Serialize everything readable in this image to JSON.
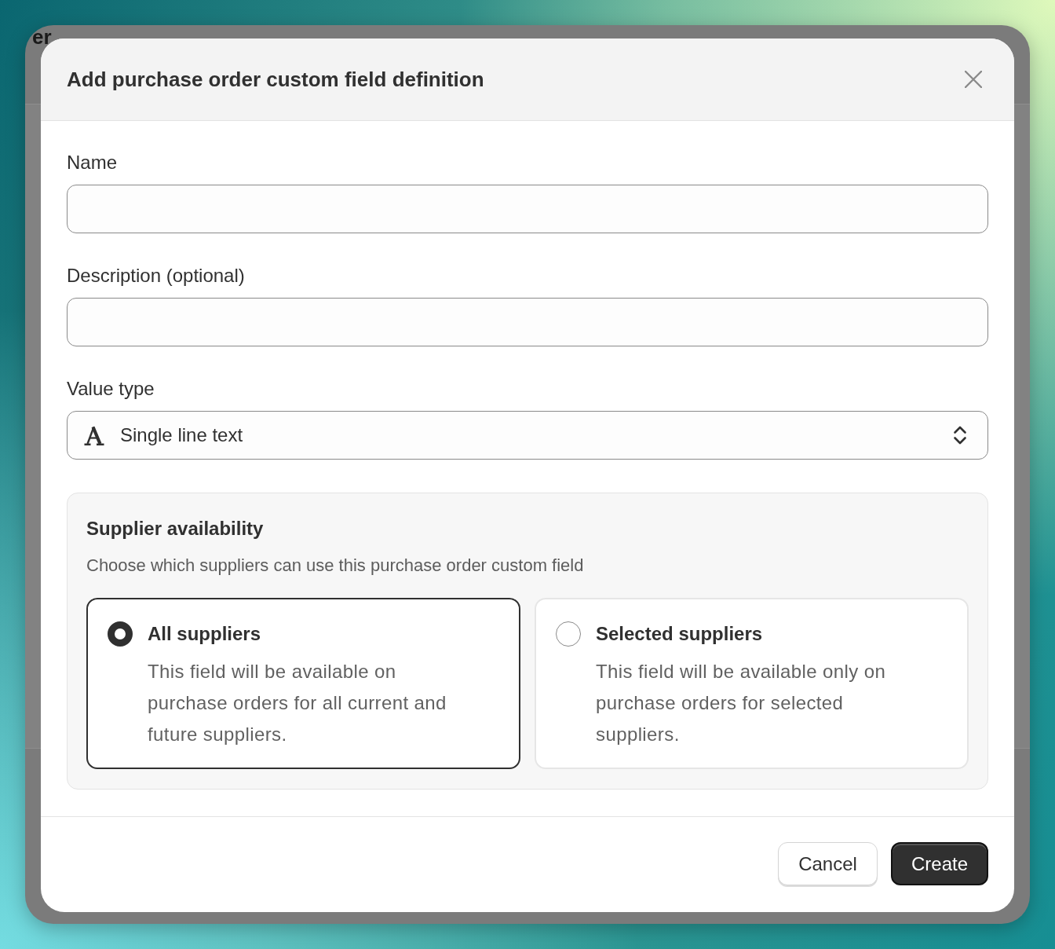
{
  "background_page": {
    "title": "er"
  },
  "dialog": {
    "title": "Add purchase order custom field definition"
  },
  "fields": [
    {
      "kind": "text",
      "label": "Name"
    },
    {
      "kind": "text",
      "label": "Description (optional)"
    },
    {
      "kind": "select",
      "label": "Value type",
      "value": "Single line text"
    }
  ],
  "supplier_availability": {
    "title": "Supplier availability",
    "description": "Choose which suppliers can use this purchase order custom field",
    "options": [
      {
        "label": "All suppliers",
        "description": "This field will be available on purchase orders for all current and future suppliers.",
        "selected": true
      },
      {
        "label": "Selected suppliers",
        "description": "This field will be available only on purchase orders for selected suppliers.",
        "selected": false
      }
    ]
  },
  "buttons": [
    {
      "kind": "secondary",
      "label": "Cancel"
    },
    {
      "kind": "primary",
      "label": "Create"
    }
  ]
}
